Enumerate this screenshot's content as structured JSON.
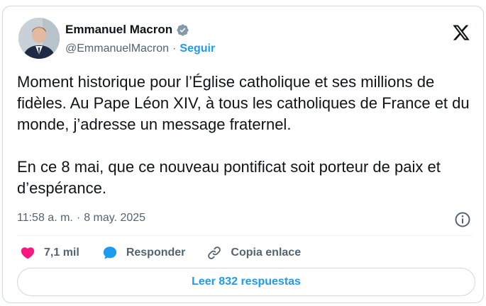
{
  "author": {
    "name": "Emmanuel Macron",
    "handle": "@EmmanuelMacron",
    "separator": "·",
    "follow_label": "Seguir",
    "verified_icon": "verified-badge-icon",
    "avatar": "profile-photo"
  },
  "brand_icon": "x-logo-icon",
  "tweet": {
    "paragraphs": [
      "Moment historique pour l’Église catholique et ses millions de fidèles. Au Pape Léon XIV, à tous les catholiques de France et du monde, j’adresse un message fraternel.",
      "En ce 8 mai, que ce nouveau pontificat soit porteur de paix et d’espérance."
    ],
    "time": "11:58 a. m.",
    "separator": "·",
    "date": "8 may. 2025",
    "info_icon": "info-icon"
  },
  "actions": {
    "likes": "7,1 mil",
    "reply_label": "Responder",
    "copy_label": "Copia enlace"
  },
  "read_replies_label": "Leer 832 respuestas",
  "colors": {
    "accent": "#1d9bf0",
    "like": "#f91880",
    "text": "#0f1419",
    "muted": "#536471",
    "border": "#cfd9de"
  }
}
